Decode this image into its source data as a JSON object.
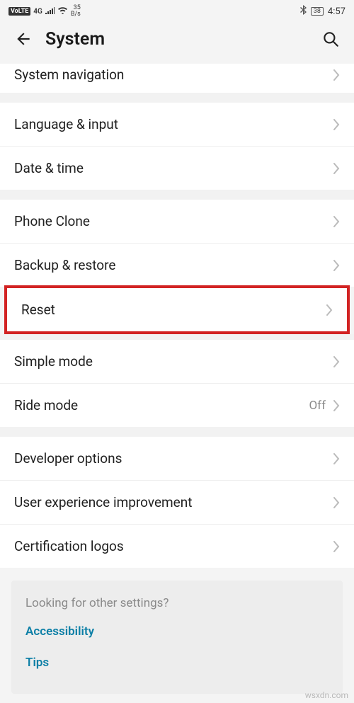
{
  "status": {
    "volte": "VoLTE",
    "signal": "4G",
    "speed_value": "35",
    "speed_unit": "B/s",
    "battery": "38",
    "time": "4:57"
  },
  "header": {
    "title": "System"
  },
  "rows": {
    "system_navigation": "System navigation",
    "language_input": "Language & input",
    "date_time": "Date & time",
    "phone_clone": "Phone Clone",
    "backup_restore": "Backup & restore",
    "reset": "Reset",
    "simple_mode": "Simple mode",
    "ride_mode": "Ride mode",
    "ride_mode_value": "Off",
    "developer_options": "Developer options",
    "user_experience": "User experience improvement",
    "certification_logos": "Certification logos"
  },
  "footer": {
    "question": "Looking for other settings?",
    "accessibility": "Accessibility",
    "tips": "Tips"
  },
  "watermark": "wsxdn.com"
}
